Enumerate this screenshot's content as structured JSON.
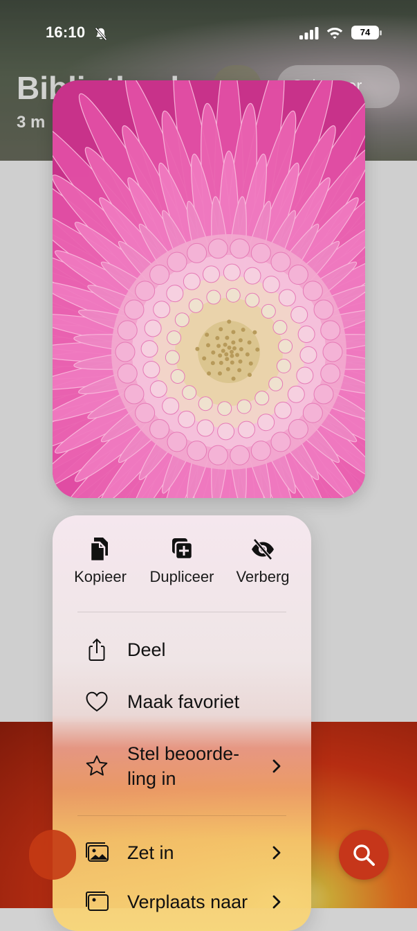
{
  "status_bar": {
    "time": "16:10",
    "battery": "74"
  },
  "background": {
    "title": "Bibliotheek",
    "subtitle": "3 m",
    "select_button": "Selecteer"
  },
  "photo": {
    "subject": "pink-gerbera-flower"
  },
  "context_menu": {
    "quick_actions": [
      {
        "label": "Kopieer",
        "icon": "copy-icon"
      },
      {
        "label": "Dupliceer",
        "icon": "duplicate-icon"
      },
      {
        "label": "Verberg",
        "icon": "hide-icon"
      }
    ],
    "items": [
      {
        "label": "Deel",
        "icon": "share-icon"
      },
      {
        "label": "Maak favoriet",
        "icon": "heart-icon"
      },
      {
        "label_line1": "Stel beoorde-",
        "label_line2": "ling in",
        "icon": "star-icon",
        "has_submenu": true
      },
      {
        "label": "Zet in",
        "icon": "photos-icon",
        "has_submenu": true
      },
      {
        "label": "Verplaats naar",
        "icon": "album-icon",
        "has_submenu": true
      }
    ]
  },
  "colors": {
    "accent": "#c6361a",
    "flower": "#e0469f"
  }
}
